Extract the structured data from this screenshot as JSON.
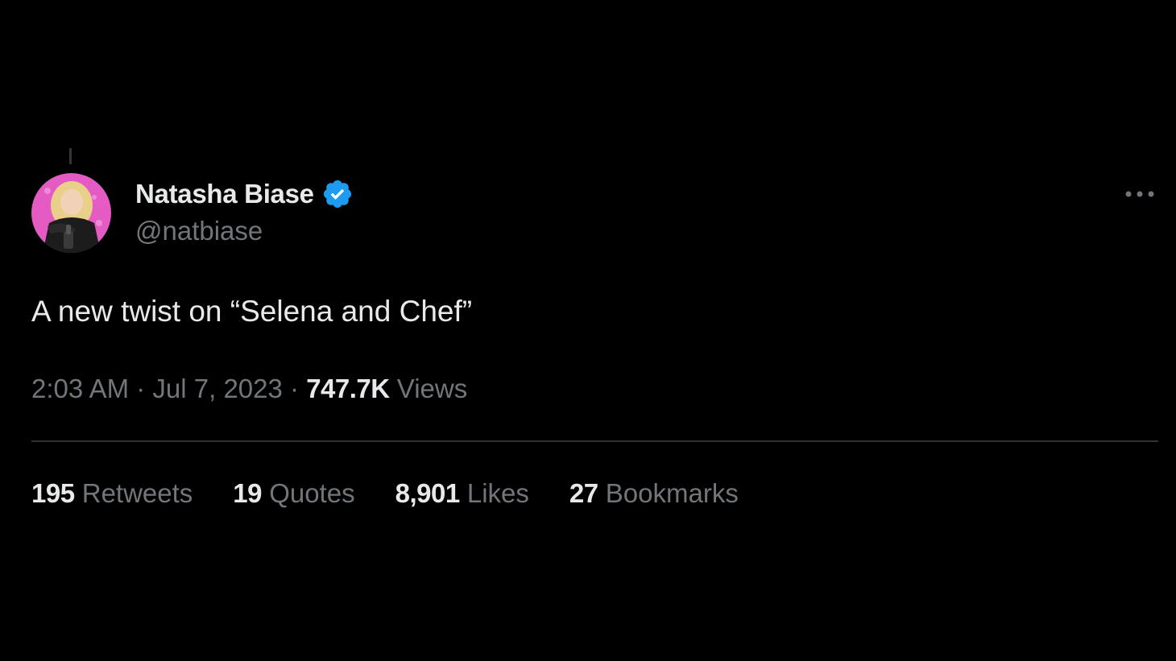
{
  "author": {
    "display_name": "Natasha Biase",
    "handle": "@natbiase",
    "verified": true,
    "verified_color": "#1d9bf0"
  },
  "tweet": {
    "text": "A new twist on “Selena and Chef”"
  },
  "meta": {
    "time": "2:03 AM",
    "separator": " · ",
    "date": "Jul 7, 2023",
    "views_count": "747.7K",
    "views_label": "Views"
  },
  "stats": {
    "retweets": {
      "count": "195",
      "label": "Retweets"
    },
    "quotes": {
      "count": "19",
      "label": "Quotes"
    },
    "likes": {
      "count": "8,901",
      "label": "Likes"
    },
    "bookmarks": {
      "count": "27",
      "label": "Bookmarks"
    }
  },
  "icons": {
    "more": "more-horizontal-icon",
    "verified": "verified-badge-icon"
  },
  "colors": {
    "background": "#000000",
    "text_primary": "#e7e9ea",
    "text_secondary": "#71767b",
    "divider": "#2f3336",
    "avatar_bg": "#e45bc4"
  }
}
